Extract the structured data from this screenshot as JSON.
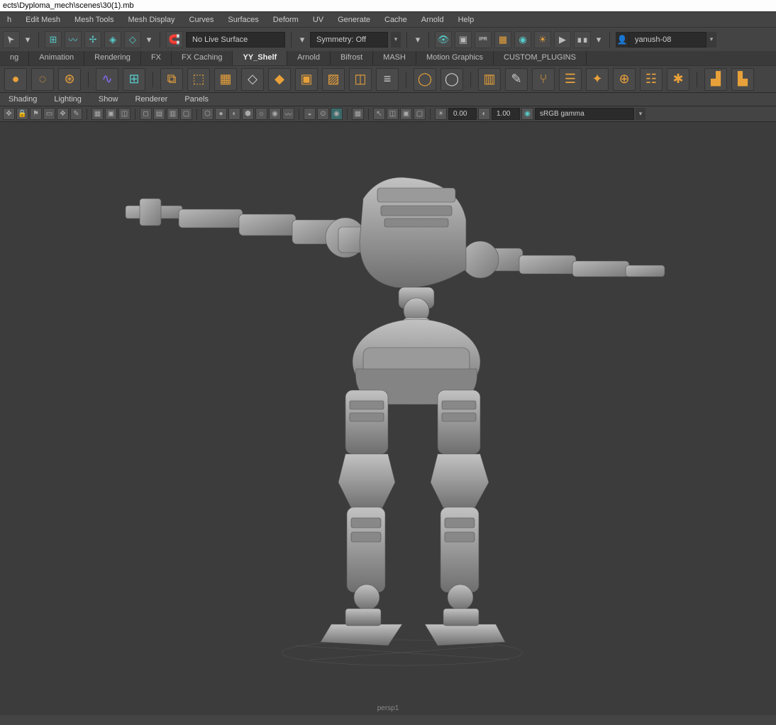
{
  "titlebar": "ects\\Dyploma_mech\\scenes\\30(1).mb",
  "main_menu": [
    "h",
    "Edit Mesh",
    "Mesh Tools",
    "Mesh Display",
    "Curves",
    "Surfaces",
    "Deform",
    "UV",
    "Generate",
    "Cache",
    "Arnold",
    "Help"
  ],
  "toolbar": {
    "live_surface": "No Live Surface",
    "symmetry": "Symmetry: Off",
    "user": "yanush-08"
  },
  "shelf_tabs": [
    {
      "label": "ng",
      "active": false
    },
    {
      "label": "Animation",
      "active": false
    },
    {
      "label": "Rendering",
      "active": false
    },
    {
      "label": "FX",
      "active": false
    },
    {
      "label": "FX Caching",
      "active": false
    },
    {
      "label": "YY_Shelf",
      "active": true
    },
    {
      "label": "Arnold",
      "active": false
    },
    {
      "label": "Bifrost",
      "active": false
    },
    {
      "label": "MASH",
      "active": false
    },
    {
      "label": "Motion Graphics",
      "active": false
    },
    {
      "label": "CUSTOM_PLUGINS",
      "active": false
    }
  ],
  "panel_menu": [
    "Shading",
    "Lighting",
    "Show",
    "Renderer",
    "Panels"
  ],
  "panel_toolbar": {
    "near": "0.00",
    "far": "1.00",
    "gamma": "sRGB gamma"
  },
  "viewport_caption": "persp1",
  "colors": {
    "viewport_bg": "#3c3c3c",
    "accent_orange": "#e8a13a",
    "accent_purple": "#8a6cff",
    "accent_cyan": "#58c9c9"
  }
}
